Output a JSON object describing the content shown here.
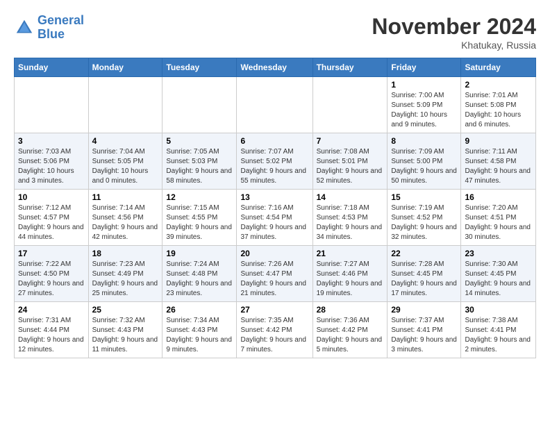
{
  "header": {
    "logo_line1": "General",
    "logo_line2": "Blue",
    "month": "November 2024",
    "location": "Khatukay, Russia"
  },
  "weekdays": [
    "Sunday",
    "Monday",
    "Tuesday",
    "Wednesday",
    "Thursday",
    "Friday",
    "Saturday"
  ],
  "weeks": [
    [
      {
        "day": "",
        "info": ""
      },
      {
        "day": "",
        "info": ""
      },
      {
        "day": "",
        "info": ""
      },
      {
        "day": "",
        "info": ""
      },
      {
        "day": "",
        "info": ""
      },
      {
        "day": "1",
        "info": "Sunrise: 7:00 AM\nSunset: 5:09 PM\nDaylight: 10 hours and 9 minutes."
      },
      {
        "day": "2",
        "info": "Sunrise: 7:01 AM\nSunset: 5:08 PM\nDaylight: 10 hours and 6 minutes."
      }
    ],
    [
      {
        "day": "3",
        "info": "Sunrise: 7:03 AM\nSunset: 5:06 PM\nDaylight: 10 hours and 3 minutes."
      },
      {
        "day": "4",
        "info": "Sunrise: 7:04 AM\nSunset: 5:05 PM\nDaylight: 10 hours and 0 minutes."
      },
      {
        "day": "5",
        "info": "Sunrise: 7:05 AM\nSunset: 5:03 PM\nDaylight: 9 hours and 58 minutes."
      },
      {
        "day": "6",
        "info": "Sunrise: 7:07 AM\nSunset: 5:02 PM\nDaylight: 9 hours and 55 minutes."
      },
      {
        "day": "7",
        "info": "Sunrise: 7:08 AM\nSunset: 5:01 PM\nDaylight: 9 hours and 52 minutes."
      },
      {
        "day": "8",
        "info": "Sunrise: 7:09 AM\nSunset: 5:00 PM\nDaylight: 9 hours and 50 minutes."
      },
      {
        "day": "9",
        "info": "Sunrise: 7:11 AM\nSunset: 4:58 PM\nDaylight: 9 hours and 47 minutes."
      }
    ],
    [
      {
        "day": "10",
        "info": "Sunrise: 7:12 AM\nSunset: 4:57 PM\nDaylight: 9 hours and 44 minutes."
      },
      {
        "day": "11",
        "info": "Sunrise: 7:14 AM\nSunset: 4:56 PM\nDaylight: 9 hours and 42 minutes."
      },
      {
        "day": "12",
        "info": "Sunrise: 7:15 AM\nSunset: 4:55 PM\nDaylight: 9 hours and 39 minutes."
      },
      {
        "day": "13",
        "info": "Sunrise: 7:16 AM\nSunset: 4:54 PM\nDaylight: 9 hours and 37 minutes."
      },
      {
        "day": "14",
        "info": "Sunrise: 7:18 AM\nSunset: 4:53 PM\nDaylight: 9 hours and 34 minutes."
      },
      {
        "day": "15",
        "info": "Sunrise: 7:19 AM\nSunset: 4:52 PM\nDaylight: 9 hours and 32 minutes."
      },
      {
        "day": "16",
        "info": "Sunrise: 7:20 AM\nSunset: 4:51 PM\nDaylight: 9 hours and 30 minutes."
      }
    ],
    [
      {
        "day": "17",
        "info": "Sunrise: 7:22 AM\nSunset: 4:50 PM\nDaylight: 9 hours and 27 minutes."
      },
      {
        "day": "18",
        "info": "Sunrise: 7:23 AM\nSunset: 4:49 PM\nDaylight: 9 hours and 25 minutes."
      },
      {
        "day": "19",
        "info": "Sunrise: 7:24 AM\nSunset: 4:48 PM\nDaylight: 9 hours and 23 minutes."
      },
      {
        "day": "20",
        "info": "Sunrise: 7:26 AM\nSunset: 4:47 PM\nDaylight: 9 hours and 21 minutes."
      },
      {
        "day": "21",
        "info": "Sunrise: 7:27 AM\nSunset: 4:46 PM\nDaylight: 9 hours and 19 minutes."
      },
      {
        "day": "22",
        "info": "Sunrise: 7:28 AM\nSunset: 4:45 PM\nDaylight: 9 hours and 17 minutes."
      },
      {
        "day": "23",
        "info": "Sunrise: 7:30 AM\nSunset: 4:45 PM\nDaylight: 9 hours and 14 minutes."
      }
    ],
    [
      {
        "day": "24",
        "info": "Sunrise: 7:31 AM\nSunset: 4:44 PM\nDaylight: 9 hours and 12 minutes."
      },
      {
        "day": "25",
        "info": "Sunrise: 7:32 AM\nSunset: 4:43 PM\nDaylight: 9 hours and 11 minutes."
      },
      {
        "day": "26",
        "info": "Sunrise: 7:34 AM\nSunset: 4:43 PM\nDaylight: 9 hours and 9 minutes."
      },
      {
        "day": "27",
        "info": "Sunrise: 7:35 AM\nSunset: 4:42 PM\nDaylight: 9 hours and 7 minutes."
      },
      {
        "day": "28",
        "info": "Sunrise: 7:36 AM\nSunset: 4:42 PM\nDaylight: 9 hours and 5 minutes."
      },
      {
        "day": "29",
        "info": "Sunrise: 7:37 AM\nSunset: 4:41 PM\nDaylight: 9 hours and 3 minutes."
      },
      {
        "day": "30",
        "info": "Sunrise: 7:38 AM\nSunset: 4:41 PM\nDaylight: 9 hours and 2 minutes."
      }
    ]
  ]
}
